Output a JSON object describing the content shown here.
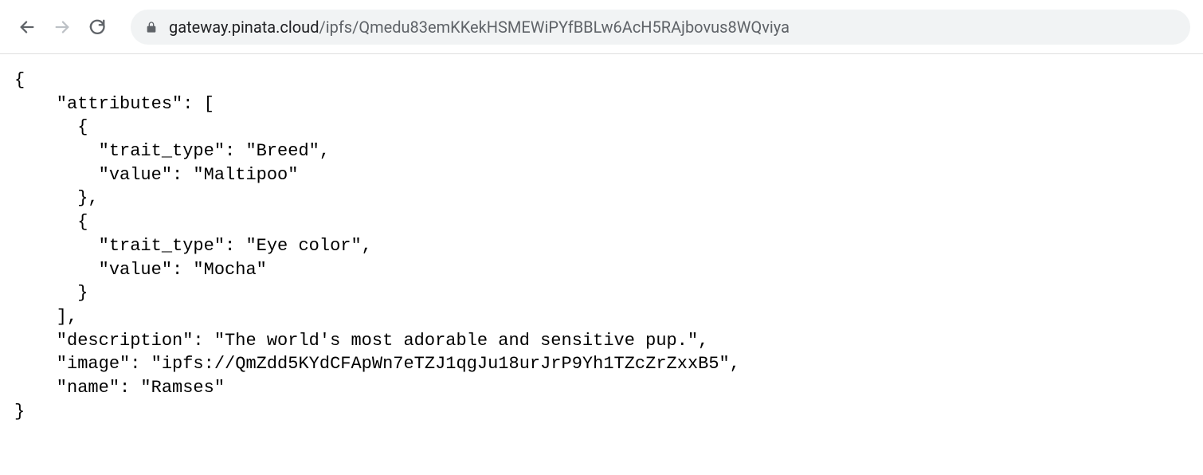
{
  "toolbar": {
    "url_domain": "gateway.pinata.cloud",
    "url_path": "/ipfs/Qmedu83emKKekHSMEWiPYfBBLw6AcH5RAjbovus8WQviya"
  },
  "json_body": {
    "line1": "{",
    "line2": "    \"attributes\": [",
    "line3": "      {",
    "line4": "        \"trait_type\": \"Breed\",",
    "line5": "        \"value\": \"Maltipoo\"",
    "line6": "      },",
    "line7": "      {",
    "line8": "        \"trait_type\": \"Eye color\",",
    "line9": "        \"value\": \"Mocha\"",
    "line10": "      }",
    "line11": "    ],",
    "line12": "    \"description\": \"The world's most adorable and sensitive pup.\",",
    "line13": "    \"image\": \"ipfs://QmZdd5KYdCFApWn7eTZJ1qgJu18urJrP9Yh1TZcZrZxxB5\",",
    "line14": "    \"name\": \"Ramses\"",
    "line15": "}"
  }
}
